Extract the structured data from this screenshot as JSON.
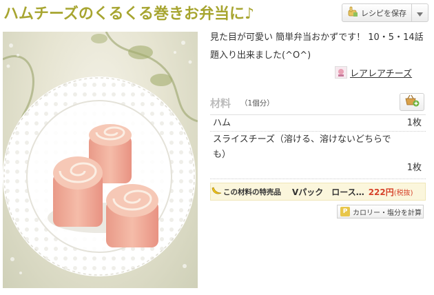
{
  "recipe": {
    "title": "ハムチーズのくるくる巻きお弁当に♪",
    "description": "見た目が可愛い 簡単弁当おかずです！ 10・5・14話題入り出来ました(^O^)"
  },
  "actions": {
    "save_label": "レシピを保存"
  },
  "author": {
    "name": "レアレアチーズ"
  },
  "ingredients": {
    "title": "材料",
    "serving": "（1個分）",
    "items": [
      {
        "name": "ハム",
        "qty": "1枚"
      },
      {
        "name": "スライスチーズ（溶ける、溶けないどちらでも）",
        "qty": "1枚"
      }
    ]
  },
  "promo": {
    "label": "この材料の特売品",
    "product": "Vパック　ロース…",
    "price": "222円",
    "tax": "(税抜)"
  },
  "calorie": {
    "badge": "P",
    "label": "カロリー・塩分を計算"
  },
  "colors": {
    "title": "#a7a530",
    "price": "#d6422a",
    "promo_bg": "#fbf6dc"
  },
  "icons": [
    "save-hand-icon",
    "dropdown-arrow-icon",
    "basket-add-icon",
    "banana-icon",
    "author-avatar-icon"
  ]
}
